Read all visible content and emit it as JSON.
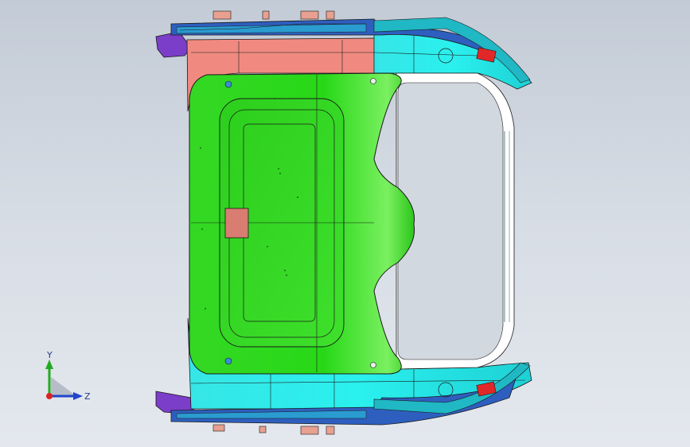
{
  "viewport": {
    "background_top": "#c3cbd6",
    "background_bottom": "#e4e8ee"
  },
  "model": {
    "panel_color": "#22dd11",
    "frame_color": "#22eeee",
    "rear_bracket_color": "#f08a80",
    "edge_color": "#1a1a1a",
    "trim_color": "#7a3ec8",
    "rail_color": "#2e5fbf"
  },
  "triad": {
    "y_label": "Y",
    "z_label": "Z",
    "y_color": "#22aa22",
    "z_color": "#2244cc",
    "x_color": "#dd2222",
    "icons": [
      "y-axis-arrow-icon",
      "z-axis-arrow-icon",
      "x-axis-dot-icon"
    ]
  }
}
